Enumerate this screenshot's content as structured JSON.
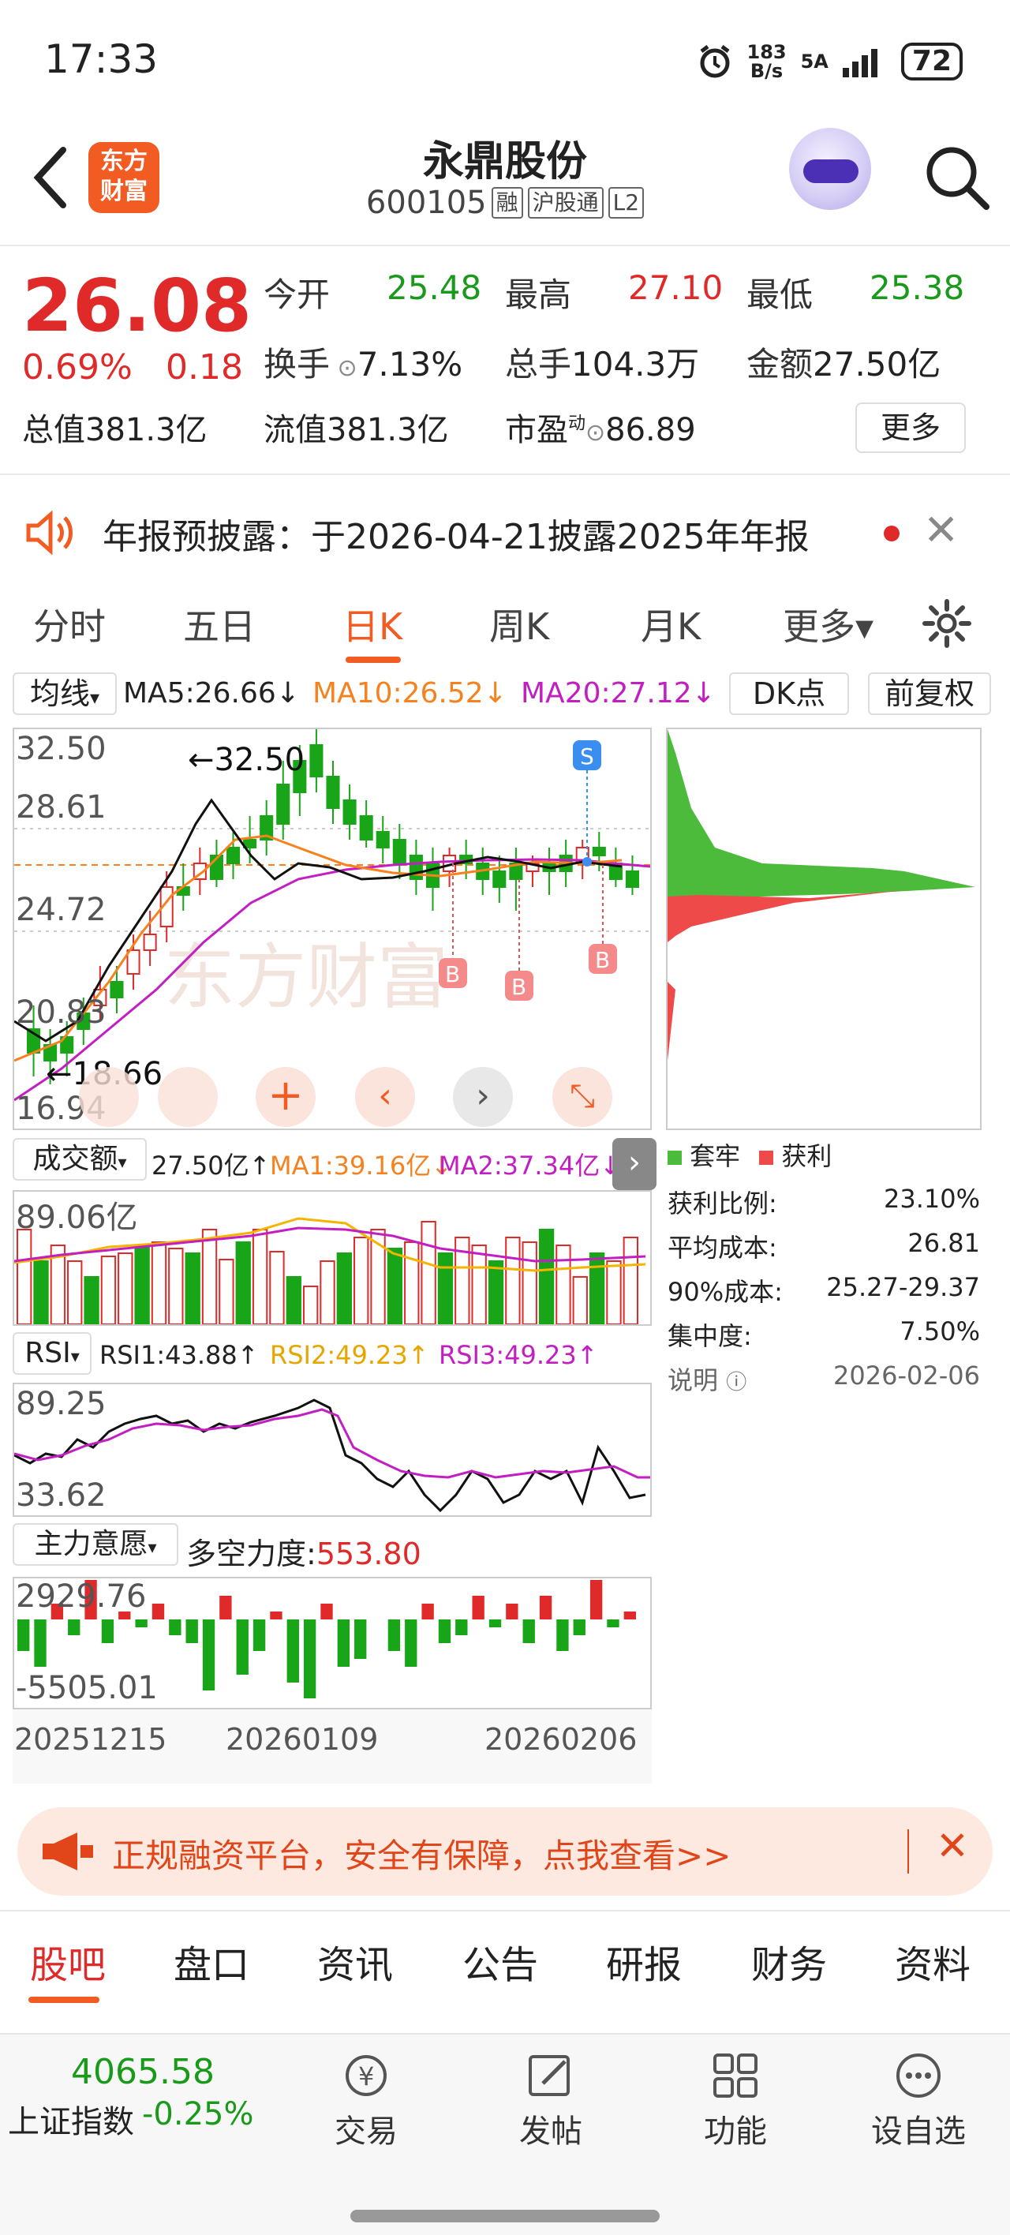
{
  "status_bar": {
    "time": "17:33",
    "net_speed_top": "183",
    "net_speed_unit": "B/s",
    "network": "5A",
    "battery": "72"
  },
  "header": {
    "logo_text_line1": "东方",
    "logo_text_line2": "财富",
    "title": "永鼎股份",
    "code": "600105",
    "tag1": "融",
    "tag2": "沪股通",
    "tag3": "L2"
  },
  "quote": {
    "price": "26.08",
    "change_pct": "0.69%",
    "change_abs": "0.18",
    "open_label": "今开",
    "open": "25.48",
    "high_label": "最高",
    "high": "27.10",
    "low_label": "最低",
    "low": "25.38",
    "turnover_label": "换手",
    "turnover": "7.13%",
    "volume_label": "总手",
    "volume": "104.3万",
    "amount_label": "金额",
    "amount": "27.50亿",
    "total_cap_label": "总值",
    "total_cap": "381.3亿",
    "float_cap_label": "流值",
    "float_cap": "381.3亿",
    "pe_label": "市盈",
    "pe_sup": "动",
    "pe": "86.89",
    "more": "更多"
  },
  "notice": {
    "text": "年报预披露：于2026-04-21披露2025年年报"
  },
  "k_tabs": [
    "分时",
    "五日",
    "日K",
    "周K",
    "月K",
    "更多▾"
  ],
  "ma": {
    "selector": "均线",
    "ma5": "MA5:26.66↓",
    "ma10": "MA10:26.52↓",
    "ma20": "MA20:27.12↓",
    "dk": "DK点",
    "fq": "前复权"
  },
  "kchart": {
    "y1": "32.50",
    "y2": "28.61",
    "y3": "24.72",
    "y4": "20.83",
    "y5": "16.94",
    "high_mark": "←32.50",
    "low_mark": "←18.66",
    "s_label": "S",
    "b_label": "B",
    "watermark": "东方财富"
  },
  "volume": {
    "selector": "成交额",
    "value": "27.50亿↑",
    "ma1": "MA1:39.16亿↓",
    "ma2": "MA2:37.34亿↓",
    "ymax": "89.06亿"
  },
  "rsi": {
    "selector": "RSI",
    "rsi1": "RSI1:43.88↑",
    "rsi2": "RSI2:49.23↑",
    "rsi3": "RSI3:49.23↑",
    "ymax": "89.25",
    "ymin": "33.62"
  },
  "zl": {
    "selector": "主力意愿",
    "label": "多空力度:",
    "value": "553.80",
    "ymax": "2929.76",
    "ymin": "-5505.01"
  },
  "dates": [
    "20251215",
    "20260109",
    "20260206"
  ],
  "chips": {
    "legend1": "套牢",
    "legend2": "获利",
    "rows": [
      {
        "label": "获利比例:",
        "value": "23.10%"
      },
      {
        "label": "平均成本:",
        "value": "26.81"
      },
      {
        "label": "90%成本:",
        "value": "25.27-29.37"
      },
      {
        "label": "集中度:",
        "value": "7.50%"
      },
      {
        "label": "说明",
        "value": "2026-02-06"
      }
    ]
  },
  "banner": {
    "text": "正规融资平台，安全有保障，点我查看>>"
  },
  "bottom_tabs": [
    "股吧",
    "盘口",
    "资讯",
    "公告",
    "研报",
    "财务",
    "资料"
  ],
  "bottom_nav": {
    "index_value": "4065.58",
    "index_label": "上证指数",
    "index_change": "-0.25%",
    "items": [
      "交易",
      "发帖",
      "功能",
      "设自选"
    ]
  }
}
